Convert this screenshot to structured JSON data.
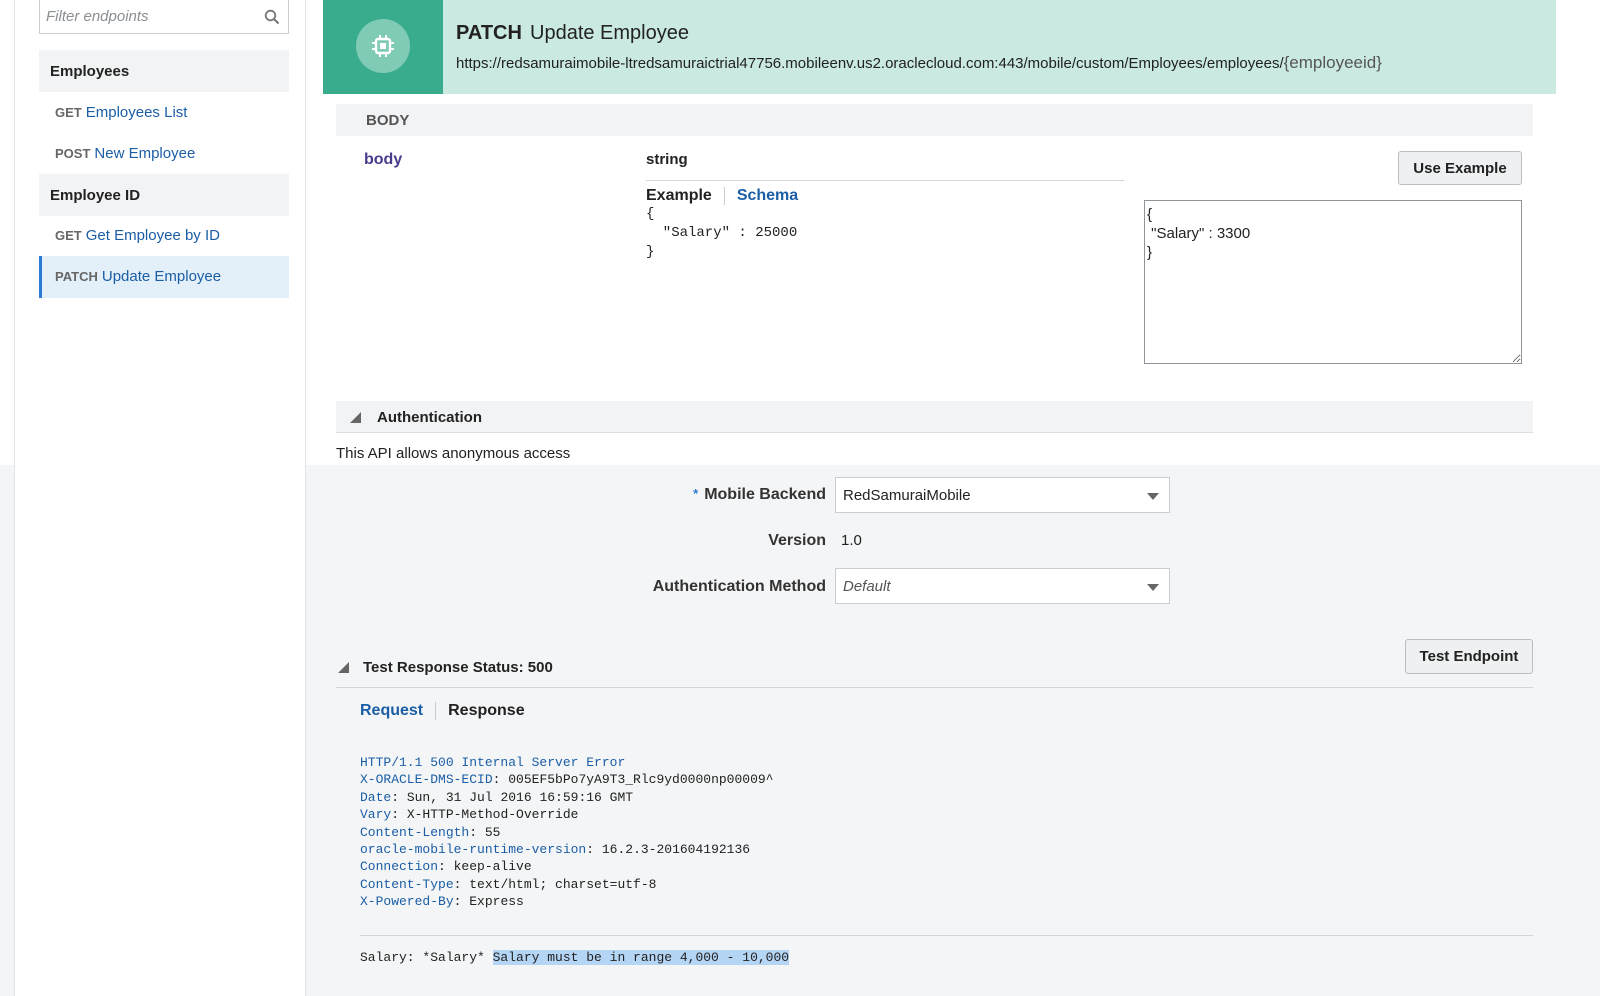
{
  "sidebar": {
    "filter_placeholder": "Filter endpoints",
    "groups": [
      {
        "label": "Employees",
        "items": [
          {
            "method": "GET",
            "label": "Employees List"
          },
          {
            "method": "POST",
            "label": "New Employee"
          }
        ]
      },
      {
        "label": "Employee ID",
        "items": [
          {
            "method": "GET",
            "label": "Get Employee by ID"
          },
          {
            "method": "PATCH",
            "label": "Update Employee",
            "active": true
          }
        ]
      }
    ]
  },
  "header": {
    "method": "PATCH",
    "title": "Update Employee",
    "url": "https://redsamuraimobile-ltredsamuraictrial47756.mobileenv.us2.oraclecloud.com:443/mobile/custom/Employees/employees/",
    "url_param": "{employeeid}",
    "icon": "chip-icon",
    "accent_color": "#3aac8e",
    "banner_color": "#c9e9e1"
  },
  "body_section": {
    "section_label": "BODY",
    "param_name": "body",
    "param_type": "string",
    "tabs": [
      "Example",
      "Schema"
    ],
    "example_code": "{\n  \"Salary\" : 25000\n}",
    "use_example_label": "Use Example",
    "body_value": "{\n \"Salary\" : 3300\n}"
  },
  "authentication": {
    "label": "Authentication",
    "anonymous_text": "This API allows anonymous access",
    "mobile_backend_label": "Mobile Backend",
    "mobile_backend_required": "*",
    "mobile_backend_value": "RedSamuraiMobile",
    "version_label": "Version",
    "version_value": "1.0",
    "auth_method_label": "Authentication Method",
    "auth_method_value": "Default"
  },
  "test": {
    "button_label": "Test Endpoint",
    "status_label": "Test Response Status: 500",
    "tabs": [
      "Request",
      "Response"
    ],
    "response_headers": [
      {
        "key": "HTTP/1.1 500 Internal Server Error",
        "value": ""
      },
      {
        "key": "X-ORACLE-DMS-ECID",
        "value": "005EF5bPo7yA9T3_Rlc9yd0000np00009^"
      },
      {
        "key": "Date",
        "value": "Sun, 31 Jul 2016 16:59:16 GMT"
      },
      {
        "key": "Vary",
        "value": "X-HTTP-Method-Override"
      },
      {
        "key": "Content-Length",
        "value": "55"
      },
      {
        "key": "oracle-mobile-runtime-version",
        "value": "16.2.3-201604192136"
      },
      {
        "key": "Connection",
        "value": "keep-alive"
      },
      {
        "key": "Content-Type",
        "value": "text/html; charset=utf-8"
      },
      {
        "key": "X-Powered-By",
        "value": "Express"
      }
    ],
    "response_body_prefix": "Salary: *Salary* ",
    "response_body_highlight": "Salary must be in range 4,000 - 10,000"
  }
}
